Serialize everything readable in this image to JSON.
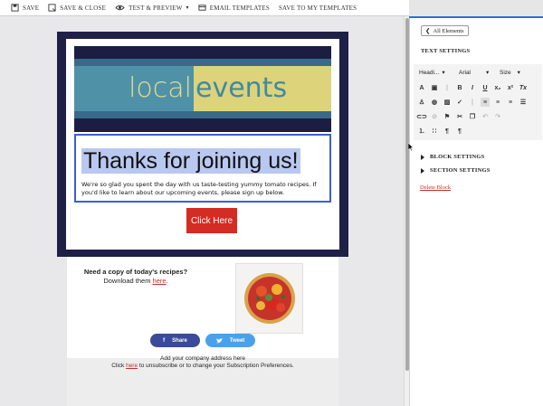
{
  "toolbar": {
    "save": "SAVE",
    "save_close": "SAVE & CLOSE",
    "test_preview": "TEST & PREVIEW",
    "email_templates": "EMAIL TEMPLATES",
    "save_templates": "SAVE TO MY TEMPLATES"
  },
  "email": {
    "banner_left": "local",
    "banner_right": "events",
    "headline": "Thanks for joining us!",
    "body": "We're so glad you spent the day with us taste-testing yummy tomato recipes. If you'd like to learn about our upcoming events, please sign up below.",
    "cta": "Click Here",
    "recipe_title": "Need a copy of today's recipes?",
    "recipe_line_prefix": "Download them ",
    "recipe_link": "here",
    "recipe_line_suffix": ".",
    "share": "Share",
    "tweet": "Tweet",
    "footer_address": "Add your company address here",
    "footer_click": "Click ",
    "footer_here": "here",
    "footer_rest": " to unsubscribe or to change your Subscription Preferences."
  },
  "panel": {
    "back": "All Elements",
    "text_settings": "TEXT SETTINGS",
    "heading_select": "Headi...",
    "font_select": "Arial",
    "size_select": "Size",
    "block_settings": "BLOCK SETTINGS",
    "section_settings": "SECTION SETTINGS",
    "delete_block": "Delete Block"
  },
  "colors": {
    "accent": "#2c6fd6",
    "modal_bg": "#1e2047",
    "cta": "#d42b22",
    "share": "#3b4b99",
    "tweet": "#4aa1eb",
    "link": "#c0312a"
  }
}
